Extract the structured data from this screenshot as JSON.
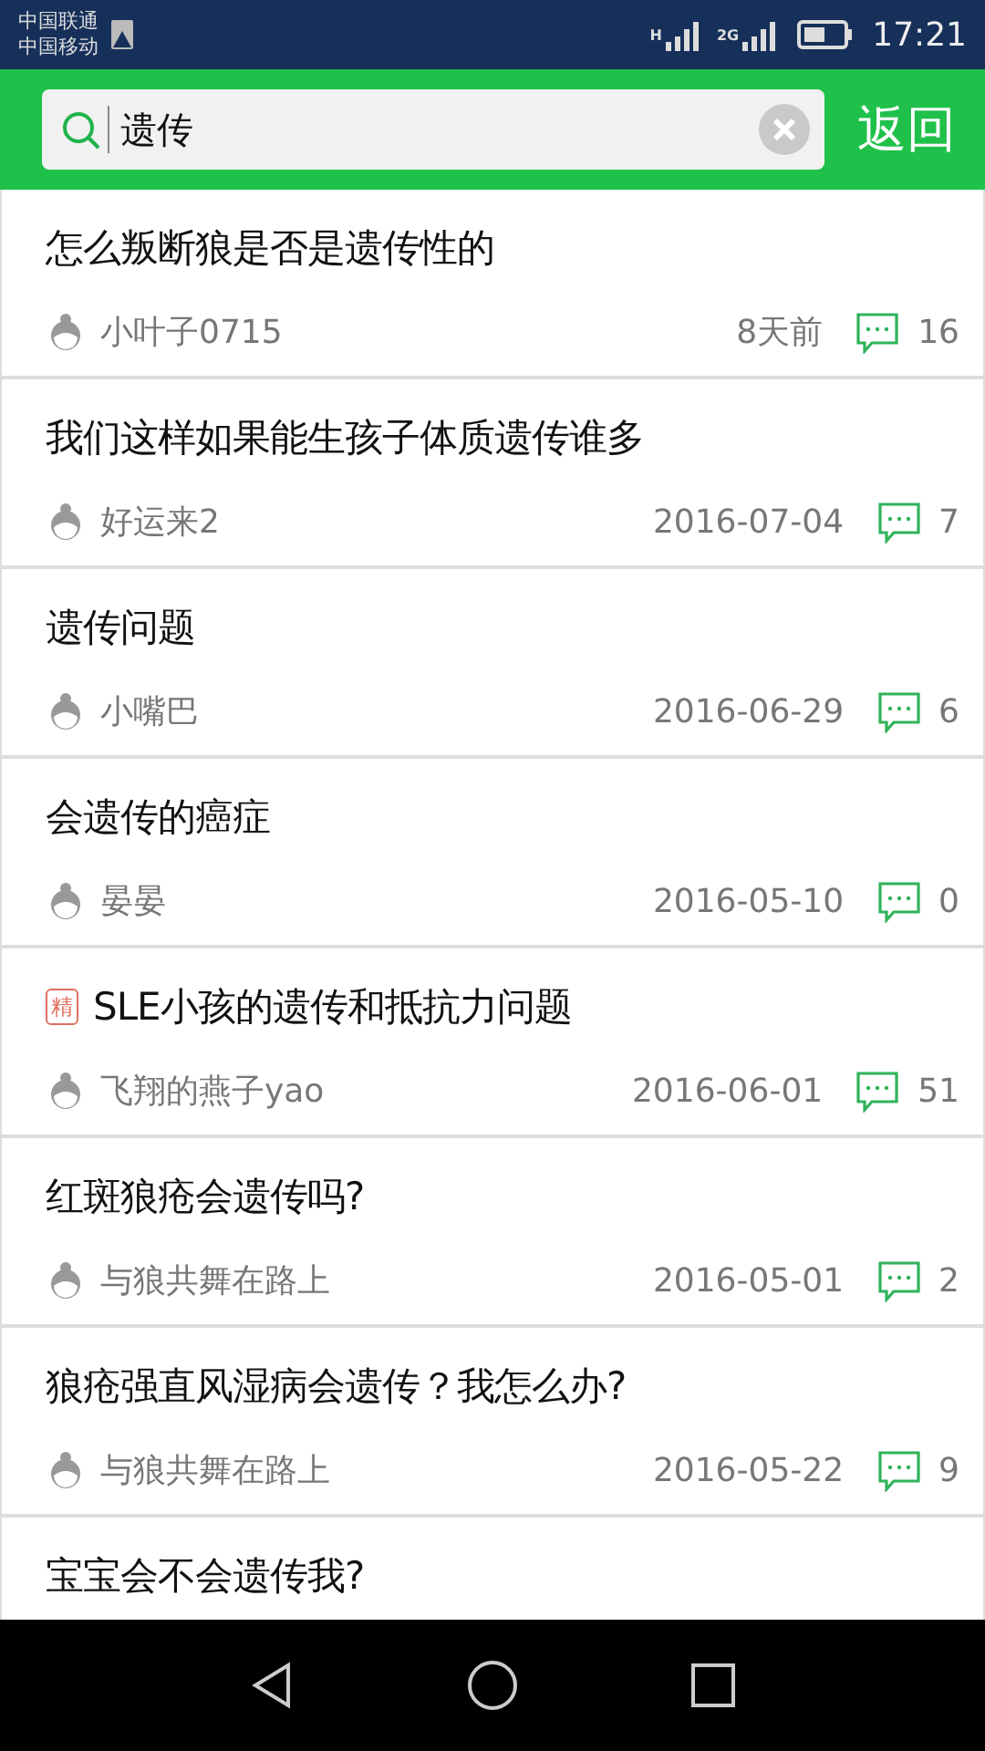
{
  "status_bar": {
    "carriers": [
      "中国联通",
      "中国移动"
    ],
    "network_1": "H",
    "network_2": "2G",
    "time": "17:21"
  },
  "search": {
    "value": "遗传",
    "back": "返回"
  },
  "topics": [
    {
      "title": "怎么叛断狼是否是遗传性的",
      "author": "小叶子0715",
      "date": "8天前",
      "comments": "16"
    },
    {
      "title": "我们这样如果能生孩子体质遗传谁多",
      "author": "好运来2",
      "date": "2016-07-04",
      "comments": "7"
    },
    {
      "title": "遗传问题",
      "author": "小嘴巴",
      "date": "2016-06-29",
      "comments": "6"
    },
    {
      "title": "会遗传的癌症",
      "author": "晏晏",
      "date": "2016-05-10",
      "comments": "0"
    },
    {
      "badge": "精",
      "title": "SLE小孩的遗传和抵抗力问题",
      "author": "飞翔的燕子yao",
      "date": "2016-06-01",
      "comments": "51"
    },
    {
      "title": "红斑狼疮会遗传吗?",
      "author": "与狼共舞在路上",
      "date": "2016-05-01",
      "comments": "2"
    },
    {
      "title": "狼疮强直风湿病会遗传？我怎么办?",
      "author": "与狼共舞在路上",
      "date": "2016-05-22",
      "comments": "9"
    },
    {
      "title": "宝宝会不会遗传我?"
    }
  ]
}
